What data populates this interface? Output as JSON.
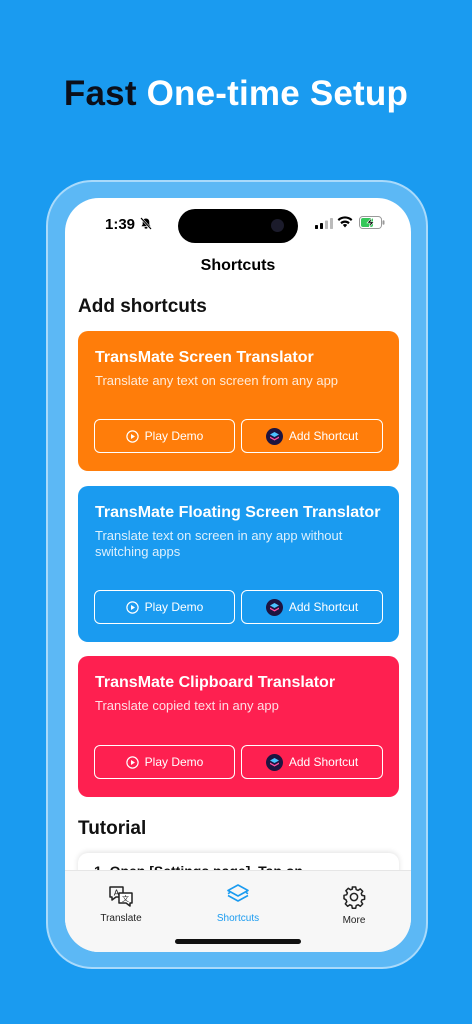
{
  "headline": {
    "part1": "Fast",
    "part2": "One-time Setup"
  },
  "status_bar": {
    "time": "1:39"
  },
  "nav": {
    "title": "Shortcuts"
  },
  "sections": {
    "add_shortcuts": "Add shortcuts",
    "tutorial": "Tutorial"
  },
  "cards": [
    {
      "title": "TransMate Screen Translator",
      "description": "Translate any text on screen from any app",
      "play_label": "Play Demo",
      "add_label": "Add Shortcut",
      "color": "#ff7d0a"
    },
    {
      "title": "TransMate Floating Screen Translator",
      "description": "Translate text on screen in any app without switching apps",
      "play_label": "Play Demo",
      "add_label": "Add Shortcut",
      "color": "#1a9bf0"
    },
    {
      "title": "TransMate Clipboard Translator",
      "description": "Translate copied text in any app",
      "play_label": "Play Demo",
      "add_label": "Add Shortcut",
      "color": "#fe2050"
    }
  ],
  "tutorial": {
    "step1": "1.    Open [Settings page], Tap on"
  },
  "tabs": [
    {
      "label": "Translate",
      "icon": "translate-icon"
    },
    {
      "label": "Shortcuts",
      "icon": "shortcuts-icon",
      "active": true
    },
    {
      "label": "More",
      "icon": "gear-icon"
    }
  ],
  "colors": {
    "background": "#1a9bf0",
    "accent": "#1a9bf0"
  }
}
